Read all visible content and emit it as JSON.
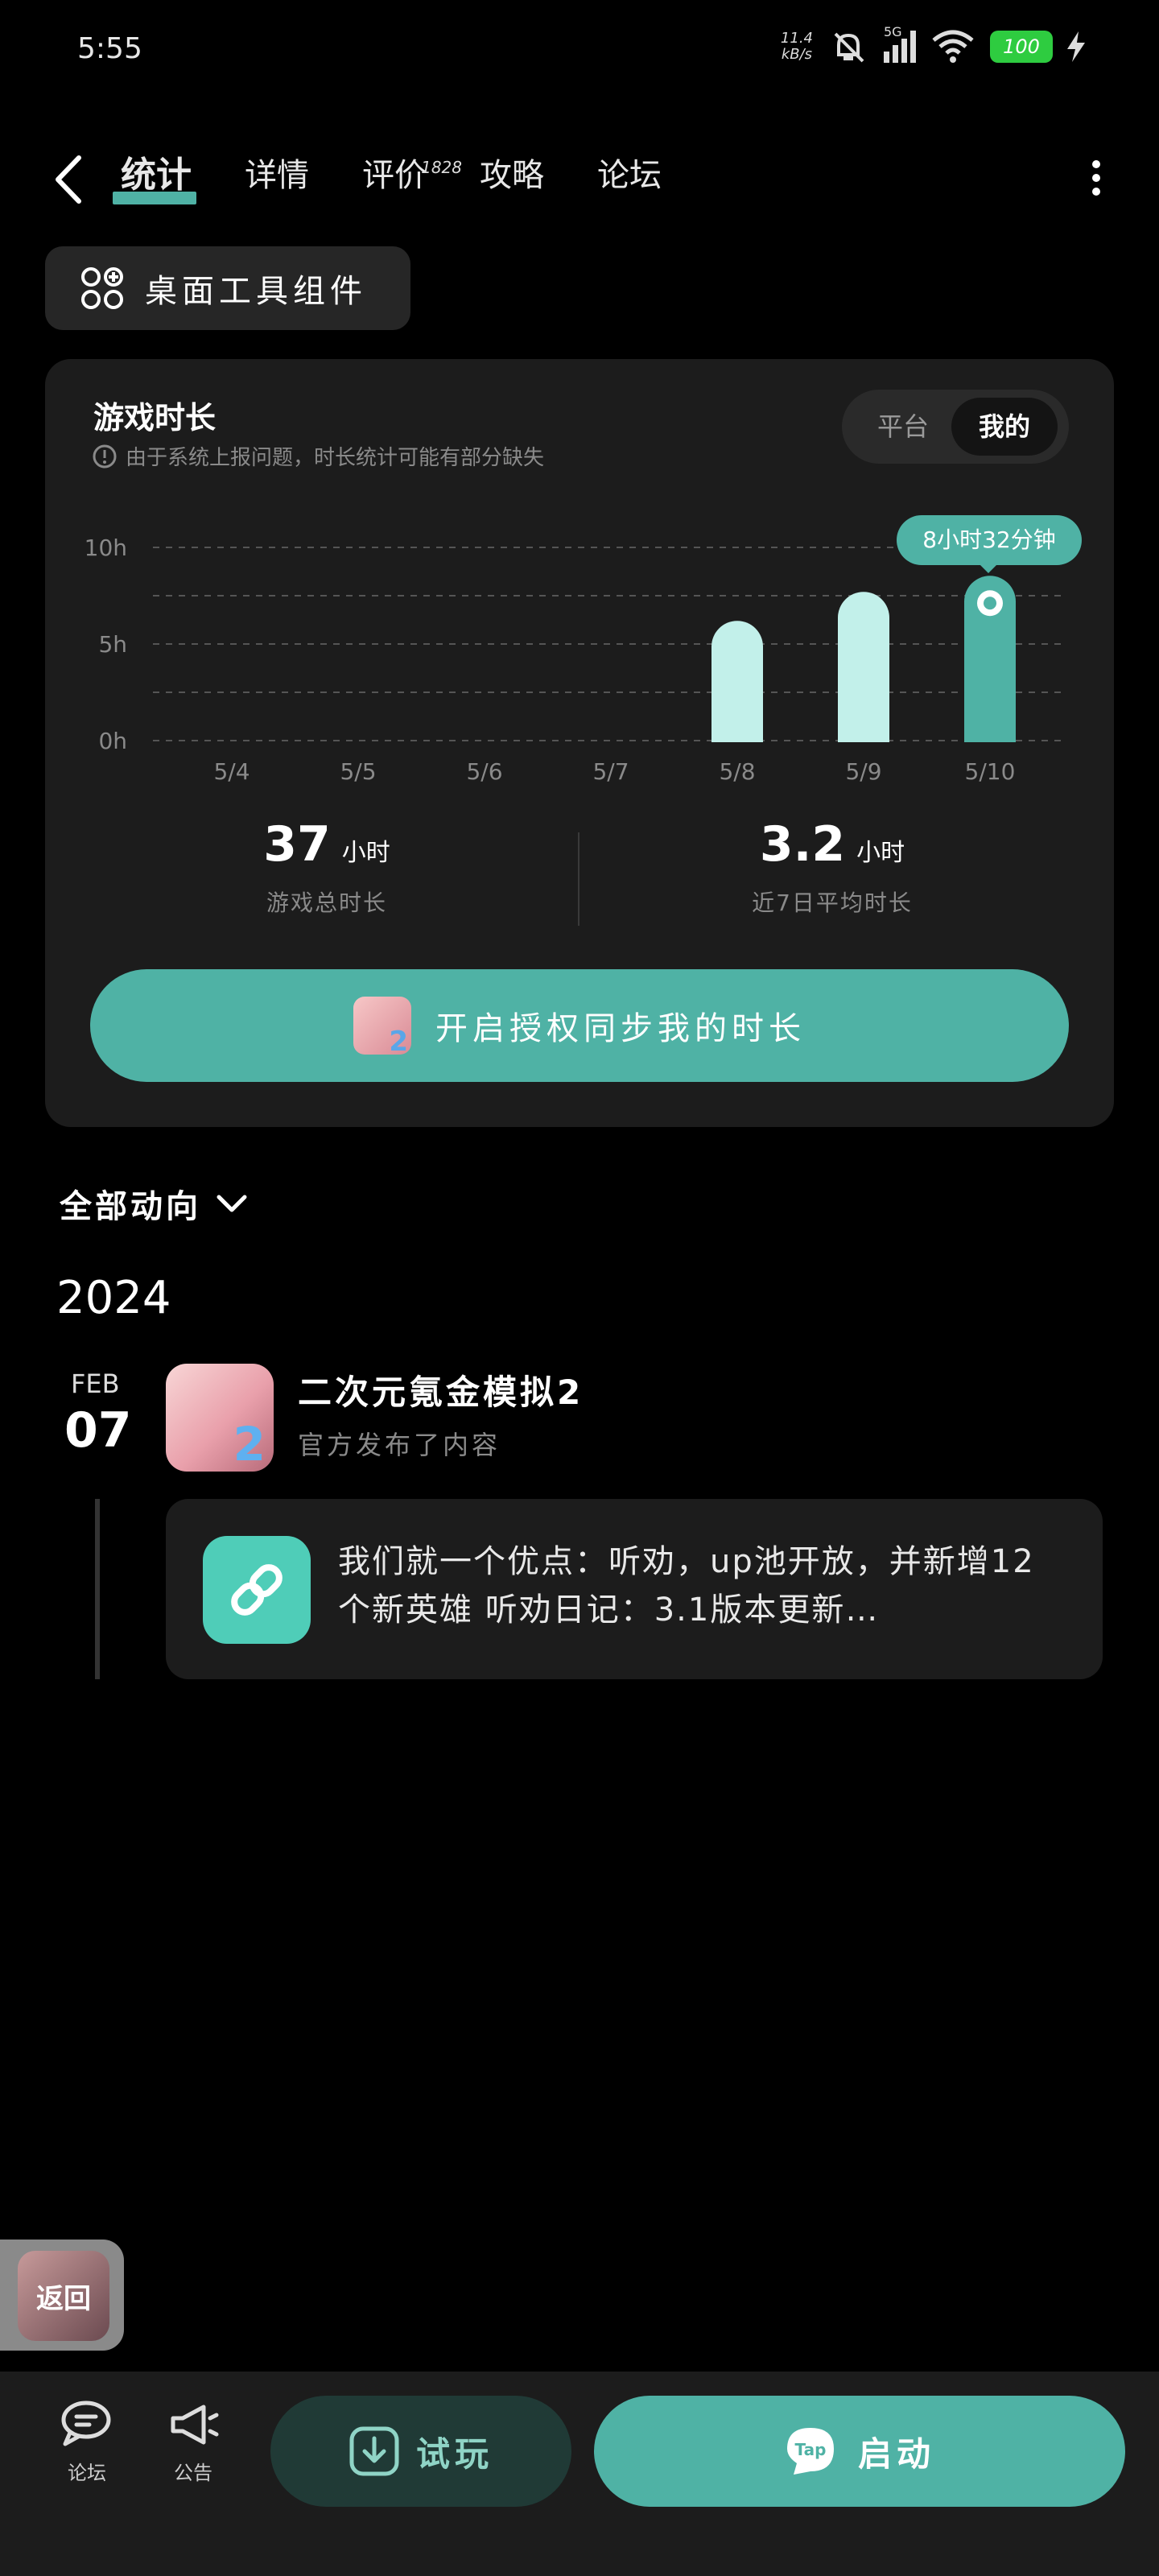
{
  "status_bar": {
    "time": "5:55",
    "net_speed_value": "11.4",
    "net_speed_unit": "kB/s",
    "network": "5G",
    "battery": "100"
  },
  "nav": {
    "tabs": [
      {
        "label": "统计",
        "active": true
      },
      {
        "label": "详情"
      },
      {
        "label": "评价",
        "badge": "1828"
      },
      {
        "label": "攻略"
      },
      {
        "label": "论坛"
      }
    ]
  },
  "widget_button": {
    "label": "桌面工具组件"
  },
  "playtime": {
    "title": "游戏时长",
    "note": "由于系统上报问题，时长统计可能有部分缺失",
    "toggle": {
      "platform": "平台",
      "mine": "我的"
    },
    "tooltip": "8小时32分钟",
    "total_value": "37",
    "total_unit": "小时",
    "total_label": "游戏总时长",
    "avg_value": "3.2",
    "avg_unit": "小时",
    "avg_label": "近7日平均时长",
    "sync_button": "开启授权同步我的时长"
  },
  "chart_data": {
    "type": "bar",
    "categories": [
      "5/4",
      "5/5",
      "5/6",
      "5/7",
      "5/8",
      "5/9",
      "5/10"
    ],
    "values": [
      0,
      0,
      0,
      0,
      6.2,
      7.7,
      8.53
    ],
    "y_ticks": [
      "10h",
      "5h",
      "0h"
    ],
    "ylim": [
      0,
      10
    ],
    "grid": true,
    "highlight_index": 6,
    "colors": {
      "bar": "#c2f0ea",
      "highlight": "#4fb2a5",
      "grid": "#555555"
    }
  },
  "activity": {
    "filter_label": "全部动向",
    "year": "2024",
    "entry": {
      "month": "FEB",
      "day": "07",
      "game_name": "二次元氪金模拟2",
      "subtitle": "官方发布了内容",
      "post_text": "我们就一个优点：听劝，up池开放，并新增12个新英雄 听劝日记：3.1版本更新…"
    }
  },
  "floating_return": {
    "label": "返回"
  },
  "bottom_bar": {
    "forum": "论坛",
    "notice": "公告",
    "try_button": "试玩",
    "launch_button": "启动",
    "tap_logo": "Tap"
  },
  "colors": {
    "accent": "#4fb2a5",
    "background": "#000000",
    "card": "#1c1c1c"
  }
}
